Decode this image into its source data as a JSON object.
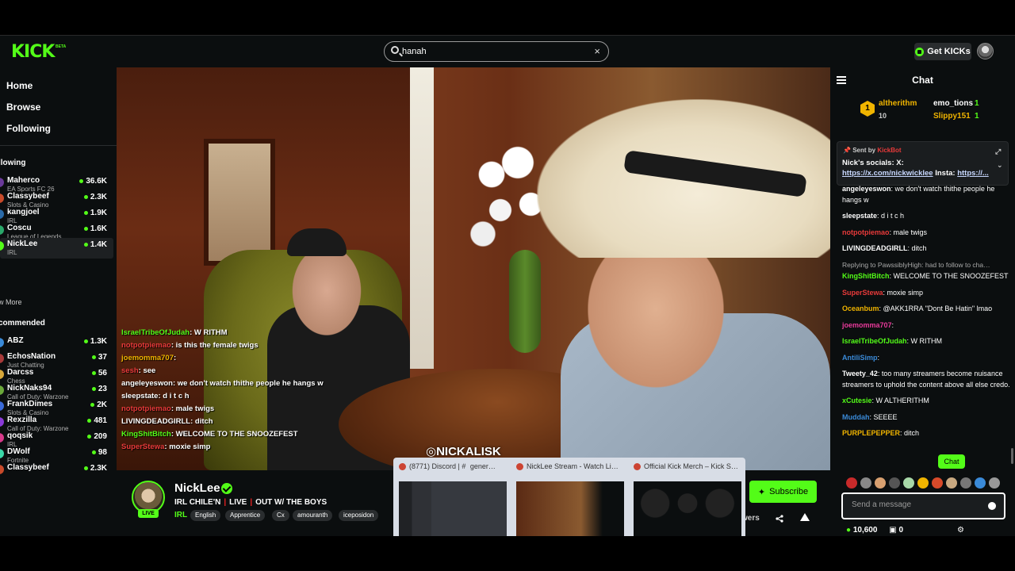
{
  "app": {
    "logo": "KICK",
    "logo_badge": "BETA"
  },
  "search": {
    "value": "hanah",
    "clear": "×"
  },
  "header": {
    "get_kicks": "Get KICKs"
  },
  "sidebar": {
    "nav": [
      "Home",
      "Browse",
      "Following"
    ],
    "following_title": "llowing",
    "following": [
      {
        "name": "Maherco",
        "category": "EA Sports FC 26",
        "viewers": "36.6K",
        "color": "#6a3a9a"
      },
      {
        "name": "Classybeef",
        "category": "Slots & Casino",
        "viewers": "2.3K",
        "color": "#c84a2a"
      },
      {
        "name": "kangjoel",
        "category": "IRL",
        "viewers": "1.9K",
        "color": "#2a6aa8"
      },
      {
        "name": "Coscu",
        "category": "League of Legends",
        "viewers": "1.6K",
        "color": "#2aa86a"
      },
      {
        "name": "NickLee",
        "category": "IRL",
        "viewers": "1.4K",
        "color": "#53fc18"
      }
    ],
    "show_more": "w More",
    "recommended_title": "commended",
    "recommended": [
      {
        "name": "ABZ",
        "category": "",
        "viewers": "1.3K",
        "color": "#3a8ad8"
      },
      {
        "name": "EchosNation",
        "category": "Just Chatting",
        "viewers": "37",
        "color": "#a83a3a"
      },
      {
        "name": "Darcss",
        "category": "Chess",
        "viewers": "56",
        "color": "#d8a83a"
      },
      {
        "name": "NickNaks94",
        "category": "Call of Duty: Warzone",
        "viewers": "23",
        "color": "#6aa83a"
      },
      {
        "name": "FrankDimes",
        "category": "Slots & Casino",
        "viewers": "2K",
        "color": "#3a6ad8"
      },
      {
        "name": "Rexzilla",
        "category": "Call of Duty: Warzone",
        "viewers": "481",
        "color": "#8a3ad8"
      },
      {
        "name": "qoqsik",
        "category": "IRL",
        "viewers": "209",
        "color": "#d83a8a"
      },
      {
        "name": "DWolf",
        "category": "Fortnite",
        "viewers": "98",
        "color": "#3ad8a8"
      },
      {
        "name": "Classybeef",
        "category": "",
        "viewers": "2.3K",
        "color": "#c84a2a"
      }
    ]
  },
  "video": {
    "watermark": "NICKALISK",
    "overlay_chat": [
      {
        "user": "IsraelTribeOfJudah",
        "text": "W RITHM",
        "color": "#53fc18"
      },
      {
        "user": "notpotpiemao",
        "text": "is this the female twigs",
        "color": "#e83a3a"
      },
      {
        "user": "joemomma707",
        "text": "",
        "color": "#f0b400"
      },
      {
        "user": "sesh",
        "text": "see",
        "color": "#e83a3a"
      },
      {
        "user": "angeleyeswon",
        "text": "we don't watch thithe people he hangs w",
        "color": "#ffffff"
      },
      {
        "user": "sleepstate",
        "text": "d i t c h",
        "color": "#ffffff"
      },
      {
        "user": "notpotpiemao",
        "text": "male twigs",
        "color": "#e83a3a"
      },
      {
        "user": "LIVINGDEADGIRLL",
        "text": "ditch",
        "color": "#ffffff"
      },
      {
        "user": "KingShitBitch",
        "text": "WELCOME TO THE SNOOZEFEST",
        "color": "#53fc18"
      },
      {
        "user": "SuperStewa",
        "text": "moxie simp",
        "color": "#e83a3a"
      }
    ]
  },
  "stream": {
    "name": "NickLee",
    "live_badge": "LIVE",
    "title_parts": [
      "IRL CHILE'N",
      "LIVE",
      "OUT W/ THE BOYS"
    ],
    "category": "IRL",
    "tags": [
      "English",
      "Apprentice",
      "Cx",
      "amouranth",
      "iceposidon"
    ],
    "subscribe": "Subscribe",
    "viewers_label": "wers"
  },
  "tab_previews": [
    {
      "title": "(8771) Discord | #   gener…",
      "fav_color": "#5865f2"
    },
    {
      "title": "NickLee Stream - Watch Li…",
      "fav_color": "#c43a2a"
    },
    {
      "title": "Official Kick Merch – Kick S…",
      "fav_color": "#c43a2a"
    }
  ],
  "chat": {
    "title": "Chat",
    "leaderboard": [
      {
        "rank": "1",
        "name": "altherithm",
        "count": "10",
        "color": "#f0b400"
      },
      {
        "name": "emo_tions",
        "count": "1",
        "color": "#fff"
      },
      {
        "name": "Slippy151",
        "count": "1",
        "color": "#f0b400"
      }
    ],
    "pinned": {
      "sent_by_label": "Sent by",
      "sent_by_user": "KickBot",
      "text_before": "Nick's socials: X: ",
      "link1": "https://x.com/nickwicklee",
      "text_mid": " Insta: ",
      "link2": "https://..."
    },
    "messages": [
      {
        "user": "angeleyeswon",
        "text": "we don't watch thithe people he hangs w",
        "color": "#ffffff"
      },
      {
        "user": "sleepstate",
        "text": "d i t c h",
        "color": "#ffffff"
      },
      {
        "user": "notpotpiemao",
        "text": "male twigs",
        "color": "#e83a3a"
      },
      {
        "user": "LIVINGDEADGIRLL",
        "text": "ditch",
        "color": "#ffffff"
      },
      {
        "reply": "Replying to PawssiblyHigh: had to follow to cha…",
        "user": "KingShitBitch",
        "text": "WELCOME TO THE SNOOZEFEST",
        "color": "#53fc18"
      },
      {
        "user": "SuperStewa",
        "text": "moxie simp",
        "color": "#e83a3a"
      },
      {
        "user": "Oceanbum",
        "text": "@AKK1RRA \"Dont Be Hatin\" lmao",
        "color": "#f0b400"
      },
      {
        "user": "joemomma707",
        "text": "",
        "color": "#e83a9a"
      },
      {
        "user": "IsraelTribeOfJudah",
        "text": "W RITHM",
        "color": "#53fc18"
      },
      {
        "user": "AntiliSimp",
        "text": "",
        "color": "#3a8ad8"
      },
      {
        "user": "Tweety_42",
        "text": "too many streamers become nuisance streamers to uphold the content above all else credo.",
        "color": "#ffffff"
      },
      {
        "user": "xCutesie",
        "text": "W ALTHERITHM",
        "color": "#53fc18"
      },
      {
        "user": "Muddah",
        "text": "SEEEE",
        "color": "#3a8ad8"
      },
      {
        "user": "PURPLEPEPPER",
        "text": "ditch",
        "color": "#f0b400"
      }
    ],
    "input_placeholder": "Send a message",
    "kicks_count": "10,600",
    "gift_count": "0",
    "send_label": "Chat"
  }
}
